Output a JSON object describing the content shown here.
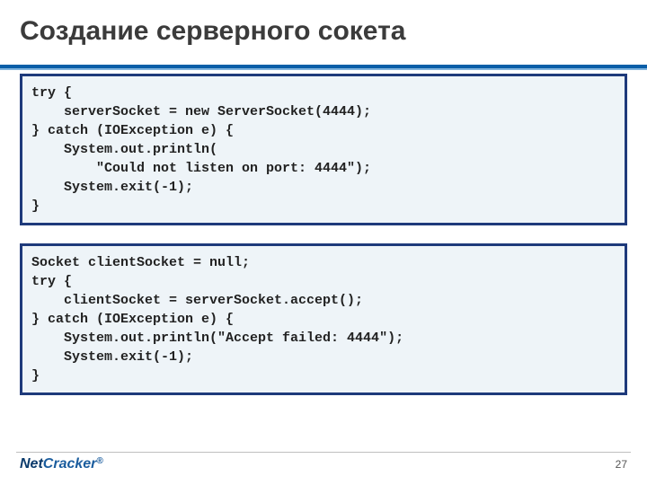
{
  "title": "Создание серверного сокета",
  "code_block_1": "try {\n    serverSocket = new ServerSocket(4444);\n} catch (IOException e) {\n    System.out.println(\n        \"Could not listen on port: 4444\");\n    System.exit(-1);\n}",
  "code_block_2": "Socket clientSocket = null;\ntry {\n    clientSocket = serverSocket.accept();\n} catch (IOException e) {\n    System.out.println(\"Accept failed: 4444\");\n    System.exit(-1);\n}",
  "logo": {
    "part1": "Net",
    "part2": "Cracker",
    "reg": "®"
  },
  "page_number": "27"
}
